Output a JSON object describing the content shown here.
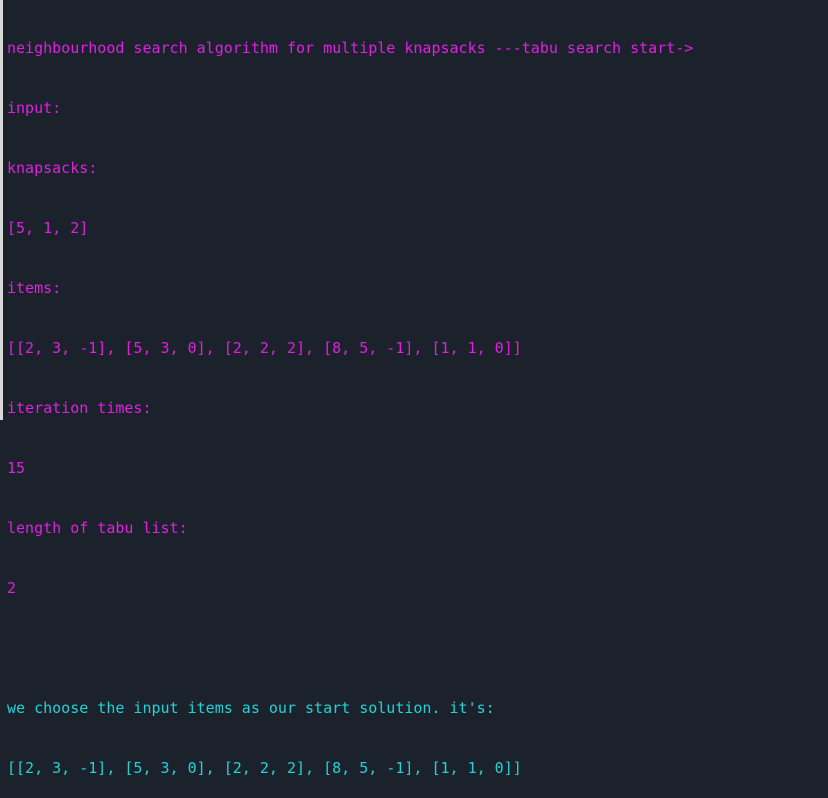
{
  "theme": {
    "background": "#1b222c",
    "magenta": "#e21ee4",
    "cyan": "#22d3d6"
  },
  "terminal": {
    "header": "neighbourhood search algorithm for multiple knapsacks ---tabu search start->",
    "input_label": "input:",
    "knapsacks_label": "knapsacks:",
    "knapsacks_value": "[5, 1, 2]",
    "items_label": "items:",
    "items_value": "[[2, 3, -1], [5, 3, 0], [2, 2, 2], [8, 5, -1], [1, 1, 0]]",
    "iteration_label": "iteration times:",
    "iteration_value": "15",
    "tabu_length_label": "length of tabu list:",
    "tabu_length_value": "2",
    "start_solution_text": "we choose the input items as our start solution. it's:",
    "start_solution_value": "[[2, 3, -1], [5, 3, 0], [2, 2, 2], [8, 5, -1], [1, 1, 0]]"
  }
}
